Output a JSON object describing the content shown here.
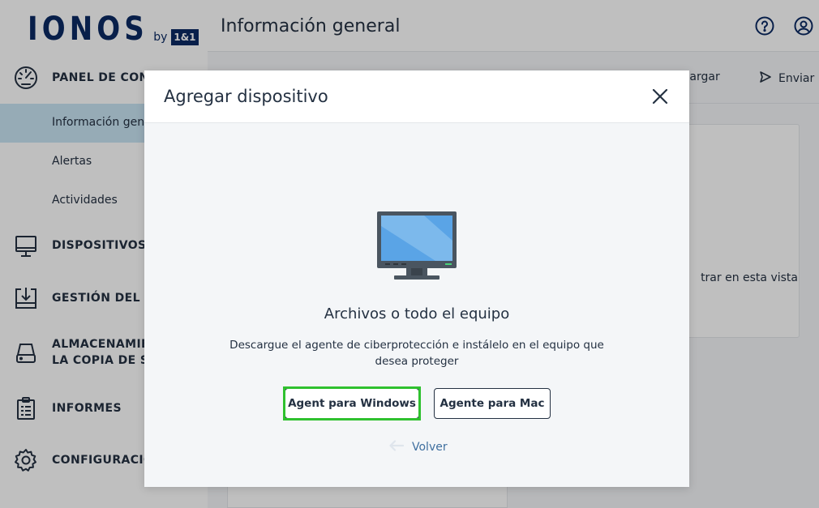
{
  "logo": {
    "word": "IONOS",
    "by": "by",
    "box": "1&1"
  },
  "sidebar": {
    "items": [
      {
        "label": "PANEL DE CONTROL",
        "icon": "dashboard-gauge-icon"
      },
      {
        "label": "DISPOSITIVOS",
        "icon": "monitor-icon"
      },
      {
        "label": "GESTIÓN DEL SOFTWARE",
        "icon": "software-download-icon"
      },
      {
        "label": "ALMACENAMIENTO DE",
        "label2": "LA COPIA DE SEGURIDAD",
        "icon": "storage-drive-icon"
      },
      {
        "label": "INFORMES",
        "icon": "clipboard-report-icon"
      },
      {
        "label": "CONFIGURACIÓN",
        "icon": "gear-icon"
      }
    ],
    "subitems": [
      {
        "label": "Información general",
        "active": true
      },
      {
        "label": "Alertas"
      },
      {
        "label": "Actividades"
      }
    ]
  },
  "header": {
    "title": "Información general",
    "help_icon": "help-icon",
    "account_icon": "account-icon"
  },
  "toolbar": {
    "download_label": "Descargar",
    "send_label": "Enviar"
  },
  "card": {
    "text": "trar en esta vista"
  },
  "modal": {
    "title": "Agregar dispositivo",
    "heading": "Archivos o todo el equipo",
    "description": "Descargue el agente de ciberprotección e instálelo en el equipo que desea proteger",
    "windows_button": "Agent para Windows",
    "mac_button": "Agente para Mac",
    "back_label": "Volver",
    "highlight_color": "#2fc12f"
  },
  "colors": {
    "brand": "#0b2a63",
    "text": "#243142",
    "active_bg": "#c8e4f3",
    "link": "#3f6f9f"
  }
}
